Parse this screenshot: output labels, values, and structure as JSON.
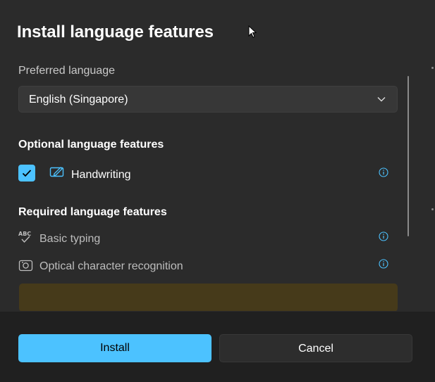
{
  "dialog": {
    "title": "Install language features",
    "preferred_language_label": "Preferred language",
    "preferred_language_value": "English (Singapore)",
    "optional_section_title": "Optional language features",
    "optional_features": [
      {
        "label": "Handwriting",
        "checked": true,
        "icon": "handwriting-icon"
      }
    ],
    "required_section_title": "Required language features",
    "required_features": [
      {
        "label": "Basic typing",
        "icon": "basic-typing-icon"
      },
      {
        "label": "Optical character recognition",
        "icon": "ocr-icon"
      }
    ],
    "buttons": {
      "install": "Install",
      "cancel": "Cancel"
    }
  },
  "colors": {
    "accent": "#4cc2ff",
    "dialog_bg": "#2b2b2b",
    "footer_bg": "#202020",
    "banner": "#463a1a"
  }
}
